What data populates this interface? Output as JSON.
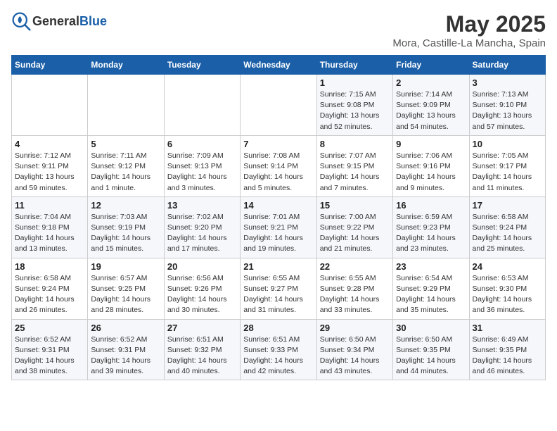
{
  "header": {
    "logo_general": "General",
    "logo_blue": "Blue",
    "title": "May 2025",
    "subtitle": "Mora, Castille-La Mancha, Spain"
  },
  "weekdays": [
    "Sunday",
    "Monday",
    "Tuesday",
    "Wednesday",
    "Thursday",
    "Friday",
    "Saturday"
  ],
  "weeks": [
    [
      {
        "day": "",
        "info": ""
      },
      {
        "day": "",
        "info": ""
      },
      {
        "day": "",
        "info": ""
      },
      {
        "day": "",
        "info": ""
      },
      {
        "day": "1",
        "info": "Sunrise: 7:15 AM\nSunset: 9:08 PM\nDaylight: 13 hours\nand 52 minutes."
      },
      {
        "day": "2",
        "info": "Sunrise: 7:14 AM\nSunset: 9:09 PM\nDaylight: 13 hours\nand 54 minutes."
      },
      {
        "day": "3",
        "info": "Sunrise: 7:13 AM\nSunset: 9:10 PM\nDaylight: 13 hours\nand 57 minutes."
      }
    ],
    [
      {
        "day": "4",
        "info": "Sunrise: 7:12 AM\nSunset: 9:11 PM\nDaylight: 13 hours\nand 59 minutes."
      },
      {
        "day": "5",
        "info": "Sunrise: 7:11 AM\nSunset: 9:12 PM\nDaylight: 14 hours\nand 1 minute."
      },
      {
        "day": "6",
        "info": "Sunrise: 7:09 AM\nSunset: 9:13 PM\nDaylight: 14 hours\nand 3 minutes."
      },
      {
        "day": "7",
        "info": "Sunrise: 7:08 AM\nSunset: 9:14 PM\nDaylight: 14 hours\nand 5 minutes."
      },
      {
        "day": "8",
        "info": "Sunrise: 7:07 AM\nSunset: 9:15 PM\nDaylight: 14 hours\nand 7 minutes."
      },
      {
        "day": "9",
        "info": "Sunrise: 7:06 AM\nSunset: 9:16 PM\nDaylight: 14 hours\nand 9 minutes."
      },
      {
        "day": "10",
        "info": "Sunrise: 7:05 AM\nSunset: 9:17 PM\nDaylight: 14 hours\nand 11 minutes."
      }
    ],
    [
      {
        "day": "11",
        "info": "Sunrise: 7:04 AM\nSunset: 9:18 PM\nDaylight: 14 hours\nand 13 minutes."
      },
      {
        "day": "12",
        "info": "Sunrise: 7:03 AM\nSunset: 9:19 PM\nDaylight: 14 hours\nand 15 minutes."
      },
      {
        "day": "13",
        "info": "Sunrise: 7:02 AM\nSunset: 9:20 PM\nDaylight: 14 hours\nand 17 minutes."
      },
      {
        "day": "14",
        "info": "Sunrise: 7:01 AM\nSunset: 9:21 PM\nDaylight: 14 hours\nand 19 minutes."
      },
      {
        "day": "15",
        "info": "Sunrise: 7:00 AM\nSunset: 9:22 PM\nDaylight: 14 hours\nand 21 minutes."
      },
      {
        "day": "16",
        "info": "Sunrise: 6:59 AM\nSunset: 9:23 PM\nDaylight: 14 hours\nand 23 minutes."
      },
      {
        "day": "17",
        "info": "Sunrise: 6:58 AM\nSunset: 9:24 PM\nDaylight: 14 hours\nand 25 minutes."
      }
    ],
    [
      {
        "day": "18",
        "info": "Sunrise: 6:58 AM\nSunset: 9:24 PM\nDaylight: 14 hours\nand 26 minutes."
      },
      {
        "day": "19",
        "info": "Sunrise: 6:57 AM\nSunset: 9:25 PM\nDaylight: 14 hours\nand 28 minutes."
      },
      {
        "day": "20",
        "info": "Sunrise: 6:56 AM\nSunset: 9:26 PM\nDaylight: 14 hours\nand 30 minutes."
      },
      {
        "day": "21",
        "info": "Sunrise: 6:55 AM\nSunset: 9:27 PM\nDaylight: 14 hours\nand 31 minutes."
      },
      {
        "day": "22",
        "info": "Sunrise: 6:55 AM\nSunset: 9:28 PM\nDaylight: 14 hours\nand 33 minutes."
      },
      {
        "day": "23",
        "info": "Sunrise: 6:54 AM\nSunset: 9:29 PM\nDaylight: 14 hours\nand 35 minutes."
      },
      {
        "day": "24",
        "info": "Sunrise: 6:53 AM\nSunset: 9:30 PM\nDaylight: 14 hours\nand 36 minutes."
      }
    ],
    [
      {
        "day": "25",
        "info": "Sunrise: 6:52 AM\nSunset: 9:31 PM\nDaylight: 14 hours\nand 38 minutes."
      },
      {
        "day": "26",
        "info": "Sunrise: 6:52 AM\nSunset: 9:31 PM\nDaylight: 14 hours\nand 39 minutes."
      },
      {
        "day": "27",
        "info": "Sunrise: 6:51 AM\nSunset: 9:32 PM\nDaylight: 14 hours\nand 40 minutes."
      },
      {
        "day": "28",
        "info": "Sunrise: 6:51 AM\nSunset: 9:33 PM\nDaylight: 14 hours\nand 42 minutes."
      },
      {
        "day": "29",
        "info": "Sunrise: 6:50 AM\nSunset: 9:34 PM\nDaylight: 14 hours\nand 43 minutes."
      },
      {
        "day": "30",
        "info": "Sunrise: 6:50 AM\nSunset: 9:35 PM\nDaylight: 14 hours\nand 44 minutes."
      },
      {
        "day": "31",
        "info": "Sunrise: 6:49 AM\nSunset: 9:35 PM\nDaylight: 14 hours\nand 46 minutes."
      }
    ]
  ]
}
